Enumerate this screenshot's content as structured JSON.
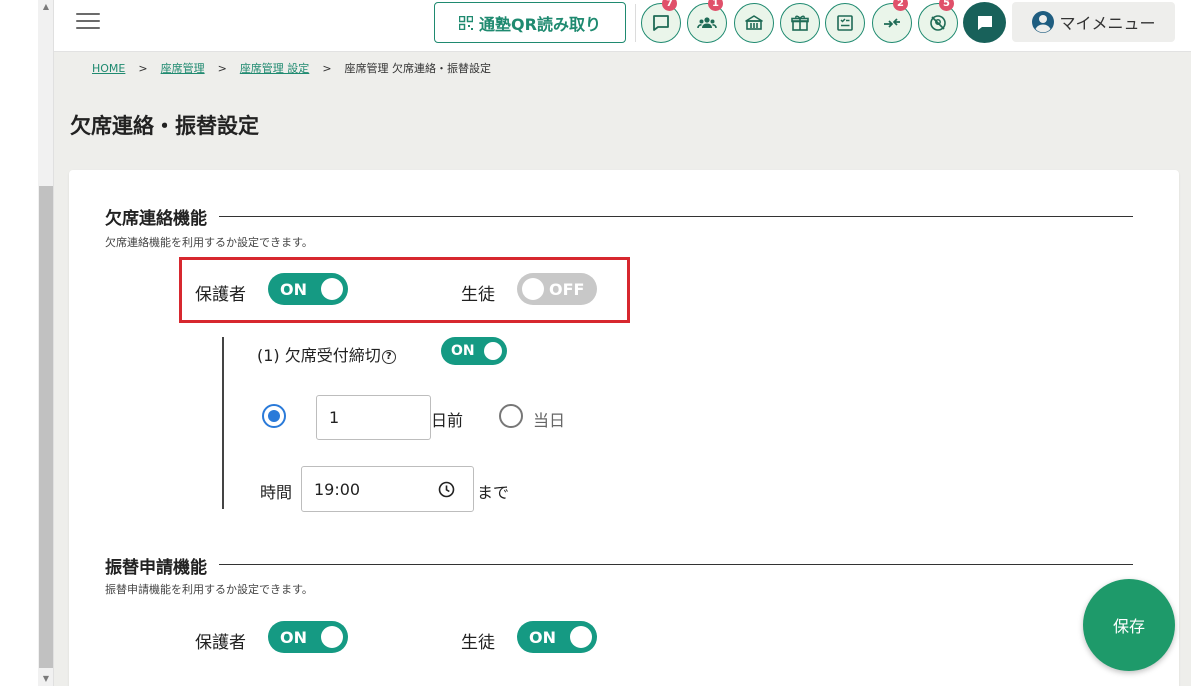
{
  "header": {
    "qr_button_label": "通塾QR読み取り",
    "icons": [
      {
        "name": "message-icon",
        "badge": "7"
      },
      {
        "name": "group-icon",
        "badge": "1"
      },
      {
        "name": "school-icon",
        "badge": ""
      },
      {
        "name": "gift-icon",
        "badge": ""
      },
      {
        "name": "checklist-icon",
        "badge": ""
      },
      {
        "name": "transfer-arrows-icon",
        "badge": "2"
      },
      {
        "name": "no-location-icon",
        "badge": "5"
      }
    ],
    "my_menu_label": "マイメニュー"
  },
  "breadcrumb": {
    "home": "HOME",
    "seat": "座席管理",
    "seat_settings": "座席管理 設定",
    "current": "座席管理 欠席連絡・振替設定",
    "separator": ">"
  },
  "page_title": "欠席連絡・振替設定",
  "absence": {
    "title": "欠席連絡機能",
    "description": "欠席連絡機能を利用するか設定できます。",
    "guardian_label": "保護者",
    "guardian_toggle": "ON",
    "student_label": "生徒",
    "student_toggle": "OFF",
    "deadline_label": "(1) 欠席受付締切",
    "help_symbol": "?",
    "deadline_toggle": "ON",
    "days_value": "1",
    "days_before_label": "日前",
    "same_day_label": "当日",
    "time_label": "時間",
    "time_value": "19:00",
    "until_label": "まで"
  },
  "transfer": {
    "title": "振替申請機能",
    "description": "振替申請機能を利用するか設定できます。",
    "guardian_label": "保護者",
    "guardian_toggle": "ON",
    "student_label": "生徒",
    "student_toggle": "ON"
  },
  "save_button": "保存",
  "colors": {
    "accent": "#159a83",
    "highlight_border": "#d7282f",
    "badge": "#e0506a",
    "radio": "#2a7ad9"
  }
}
